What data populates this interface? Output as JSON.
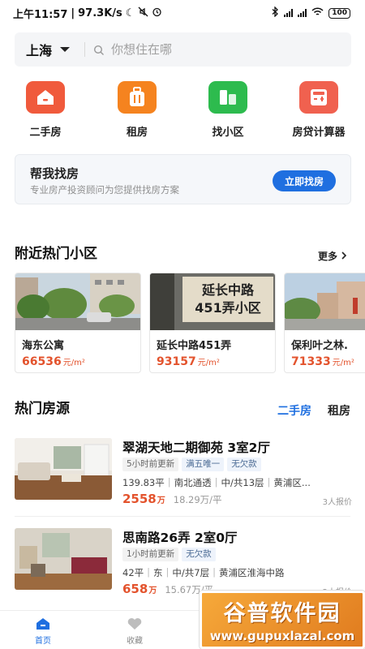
{
  "status_bar": {
    "time": "上午11:57",
    "net_speed": "97.3K/s",
    "battery": "100"
  },
  "search": {
    "city": "上海",
    "placeholder": "你想住在哪"
  },
  "shortcuts": [
    {
      "label": "二手房",
      "icon": "house-icon",
      "color": "#f05a3c"
    },
    {
      "label": "租房",
      "icon": "luggage-icon",
      "color": "#f5831f"
    },
    {
      "label": "找小区",
      "icon": "building-icon",
      "color": "#2dbb4e"
    },
    {
      "label": "房贷计算器",
      "icon": "calculator-icon",
      "color": "#f0614f"
    }
  ],
  "help_card": {
    "title": "帮我找房",
    "subtitle": "专业房产投资顾问为您提供找房方案",
    "button": "立即找房"
  },
  "nearby": {
    "title": "附近热门小区",
    "more": "更多",
    "items": [
      {
        "name": "海东公寓",
        "price": "66536",
        "unit": "元/m²"
      },
      {
        "name": "延长中路451弄",
        "price": "93157",
        "unit": "元/m²",
        "sign_line1": "延长中路",
        "sign_line2": "451弄小区"
      },
      {
        "name": "保利叶之林.",
        "price": "71333",
        "unit": "元/m²"
      }
    ]
  },
  "hot_listings": {
    "title": "热门房源",
    "tabs": [
      "二手房",
      "租房"
    ],
    "items": [
      {
        "title": "翠湖天地二期御苑 3室2厅",
        "tags": [
          {
            "text": "5小时前更新",
            "style": "grey"
          },
          {
            "text": "满五唯一",
            "style": "blue"
          },
          {
            "text": "无欠款",
            "style": "blue"
          }
        ],
        "meta": [
          "139.83平",
          "南北通透",
          "中/共13层",
          "黄浦区..."
        ],
        "price": "2558",
        "price_unit": "万",
        "unit_price": "18.29万/平",
        "reports": "3人报价"
      },
      {
        "title": "思南路26弄 2室0厅",
        "tags": [
          {
            "text": "1小时前更新",
            "style": "grey"
          },
          {
            "text": "无欠款",
            "style": "blue"
          }
        ],
        "meta": [
          "42平",
          "东",
          "中/共7层",
          "黄浦区淮海中路"
        ],
        "price": "658",
        "price_unit": "万",
        "unit_price": "15.67万/平",
        "reports": "2人报价"
      }
    ]
  },
  "bottom_nav": [
    {
      "label": "首页",
      "icon": "home-icon",
      "active": true
    },
    {
      "label": "收藏",
      "icon": "heart-icon",
      "active": false
    }
  ],
  "watermark": {
    "title": "谷普软件园",
    "url": "www.gupuxlazal.com"
  },
  "colors": {
    "accent": "#1f6fe0",
    "price": "#e3532d"
  }
}
